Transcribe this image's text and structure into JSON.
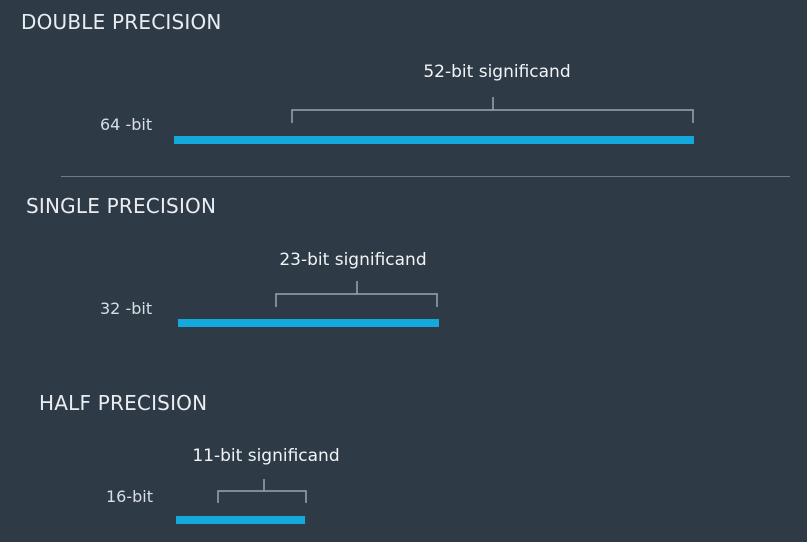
{
  "sections": [
    {
      "heading": "DOUBLE PRECISION",
      "total_label": "64 -bit",
      "significand_label": "52-bit significand"
    },
    {
      "heading": "SINGLE PRECISION",
      "total_label": "32 -bit",
      "significand_label": "23-bit significand"
    },
    {
      "heading": "HALF PRECISION",
      "total_label": "16-bit",
      "significand_label": "11-bit significand"
    }
  ],
  "colors": {
    "background": "#2f3a47",
    "bar": "#14a9dd",
    "bracket": "#9aa6b1",
    "divider": "#6f7b87",
    "text": "#e6ebef"
  }
}
